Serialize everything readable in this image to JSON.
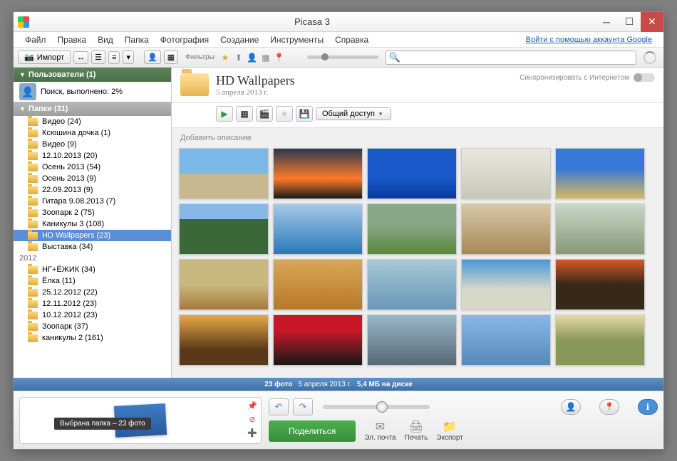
{
  "title": "Picasa 3",
  "menu": [
    "Файл",
    "Правка",
    "Вид",
    "Папка",
    "Фотография",
    "Создание",
    "Инструменты",
    "Справка"
  ],
  "google_link": "Войти с помощью аккаунта Google",
  "toolbar": {
    "import": "Импорт",
    "filters_label": "Фильтры"
  },
  "sidebar": {
    "users_hdr": "Пользователи (1)",
    "scan_status": "Поиск, выполнено: 2%",
    "folders_hdr": "Папки (31)",
    "items": [
      {
        "label": "Видео (24)"
      },
      {
        "label": "Ксюшина дочка (1)"
      },
      {
        "label": "Видео (9)"
      },
      {
        "label": "12.10.2013 (20)"
      },
      {
        "label": "Осень 2013 (54)"
      },
      {
        "label": "Осень 2013 (9)"
      },
      {
        "label": "22.09.2013 (9)"
      },
      {
        "label": "Гитара 9.08.2013 (7)"
      },
      {
        "label": "Зоопарк 2 (75)"
      },
      {
        "label": "Каникулы 3 (108)"
      },
      {
        "label": "HD Wallpapers (23)",
        "selected": true
      },
      {
        "label": "Выставка (34)"
      }
    ],
    "year": "2012",
    "items2": [
      {
        "label": "НГ+ЁЖИК (34)"
      },
      {
        "label": "Ёлка (11)"
      },
      {
        "label": "25.12.2012 (22)"
      },
      {
        "label": "12.11.2012 (23)"
      },
      {
        "label": "10.12.2012 (23)"
      },
      {
        "label": "Зоопарк (37)"
      },
      {
        "label": "каникулы 2 (161)"
      }
    ]
  },
  "folder": {
    "name": "HD Wallpapers",
    "date": "5 апреля 2013 г.",
    "sync_label": "Синхронизировать с Интернетом",
    "share_label": "Общий доступ",
    "desc_placeholder": "Добавить описание"
  },
  "status": {
    "count": "23 фото",
    "date": "5 апреля 2013 г.",
    "size": "5,4 МБ на диске"
  },
  "tray": {
    "tooltip": "Выбрана папка – 23 фото",
    "share": "Поделиться",
    "email": "Эл. почта",
    "print": "Печать",
    "export": "Экспорт"
  }
}
